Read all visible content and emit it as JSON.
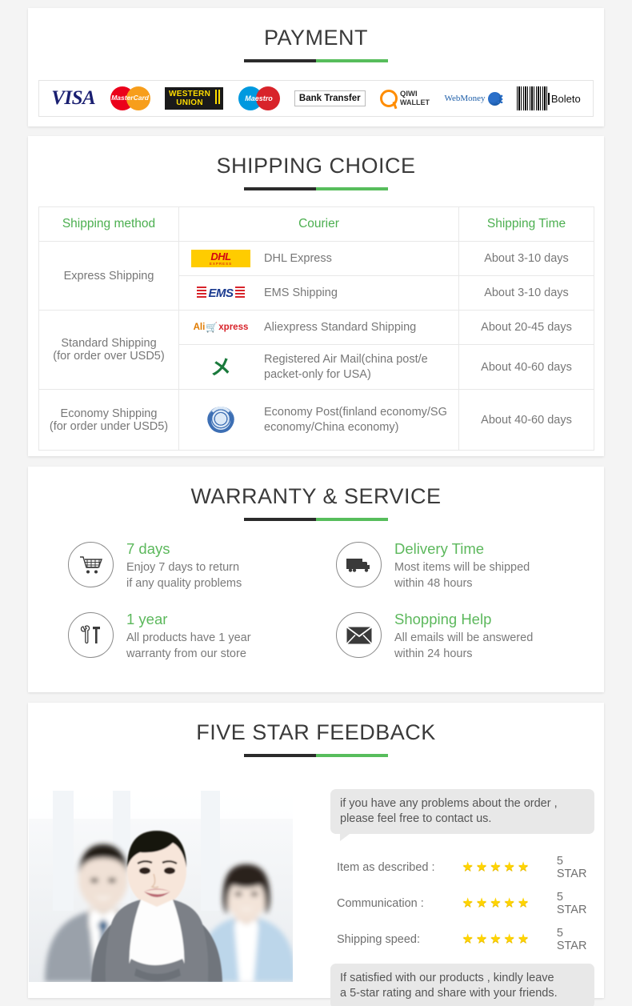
{
  "payment": {
    "title": "PAYMENT",
    "methods": [
      {
        "name": "visa-logo",
        "label": "VISA"
      },
      {
        "name": "mastercard-logo",
        "label": "MasterCard"
      },
      {
        "name": "western-union-logo",
        "label_line1": "WESTERN",
        "label_line2": "UNION"
      },
      {
        "name": "maestro-logo",
        "label": "Maestro"
      },
      {
        "name": "bank-transfer-logo",
        "label": "Bank Transfer"
      },
      {
        "name": "qiwi-wallet-logo",
        "label_line1": "QIWI",
        "label_line2": "WALLET"
      },
      {
        "name": "webmoney-logo",
        "label": "WebMoney"
      },
      {
        "name": "boleto-logo",
        "label": "Boleto"
      }
    ]
  },
  "shipping": {
    "title": "SHIPPING CHOICE",
    "columns": [
      "Shipping method",
      "Courier",
      "Shipping Time"
    ],
    "rows": [
      {
        "method": "Express Shipping",
        "method_rowspan": 2,
        "logo": "dhl-logo",
        "courier": "DHL Express",
        "time": "About 3-10 days"
      },
      {
        "method": "",
        "logo": "ems-logo",
        "courier": "EMS Shipping",
        "time": "About 3-10 days"
      },
      {
        "method": "Standard Shipping\n(for order over USD5)",
        "method_line1": "Standard Shipping",
        "method_line2": "(for order over USD5)",
        "method_rowspan": 2,
        "logo": "aliexpress-logo",
        "courier": "Aliexpress Standard Shipping",
        "time": "About 20-45 days"
      },
      {
        "method": "",
        "logo": "china-post-logo",
        "courier": "Registered Air Mail(china post/e packet-only for USA)",
        "time": "About 40-60 days"
      },
      {
        "method_line1": "Economy Shipping",
        "method_line2": "(for order under USD5)",
        "method_rowspan": 1,
        "logo": "united-nations-logo",
        "courier": "Economy Post(finland economy/SG economy/China economy)",
        "time": "About 40-60 days"
      }
    ]
  },
  "warranty": {
    "title": "WARRANTY & SERVICE",
    "items": [
      {
        "icon": "shopping-cart-icon",
        "heading": "7 days",
        "line1": "Enjoy 7 days to return",
        "line2": "if any quality problems"
      },
      {
        "icon": "delivery-truck-icon",
        "heading": "Delivery Time",
        "line1": "Most items will be shipped",
        "line2": "within 48 hours"
      },
      {
        "icon": "tools-icon",
        "heading": "1 year",
        "line1": "All products have 1 year",
        "line2": "warranty from our store"
      },
      {
        "icon": "envelope-icon",
        "heading": "Shopping Help",
        "line1": "All emails will be answered",
        "line2": "within 24 hours"
      }
    ]
  },
  "feedback": {
    "title": "FIVE STAR FEEDBACK",
    "photo_alt": "business-team-photo",
    "bubble_top_line1": "if you have any problems about the order ,",
    "bubble_top_line2": "please feel free to contact us.",
    "ratings": [
      {
        "label": "Item as described :",
        "stars": 5,
        "value": "5 STAR"
      },
      {
        "label": "Communication :",
        "stars": 5,
        "value": "5 STAR"
      },
      {
        "label": "Shipping speed:",
        "stars": 5,
        "value": "5 STAR"
      }
    ],
    "bubble_bottom_line1": "If satisfied with our products ,  kindly leave",
    "bubble_bottom_line2": "a 5-star rating and share with your friends."
  },
  "colors": {
    "accent_green": "#5cb85c",
    "title_dark": "#3a3a3a",
    "body_gray": "#777777",
    "star_yellow": "#ffd400",
    "page_bg": "#f4f4f4"
  }
}
